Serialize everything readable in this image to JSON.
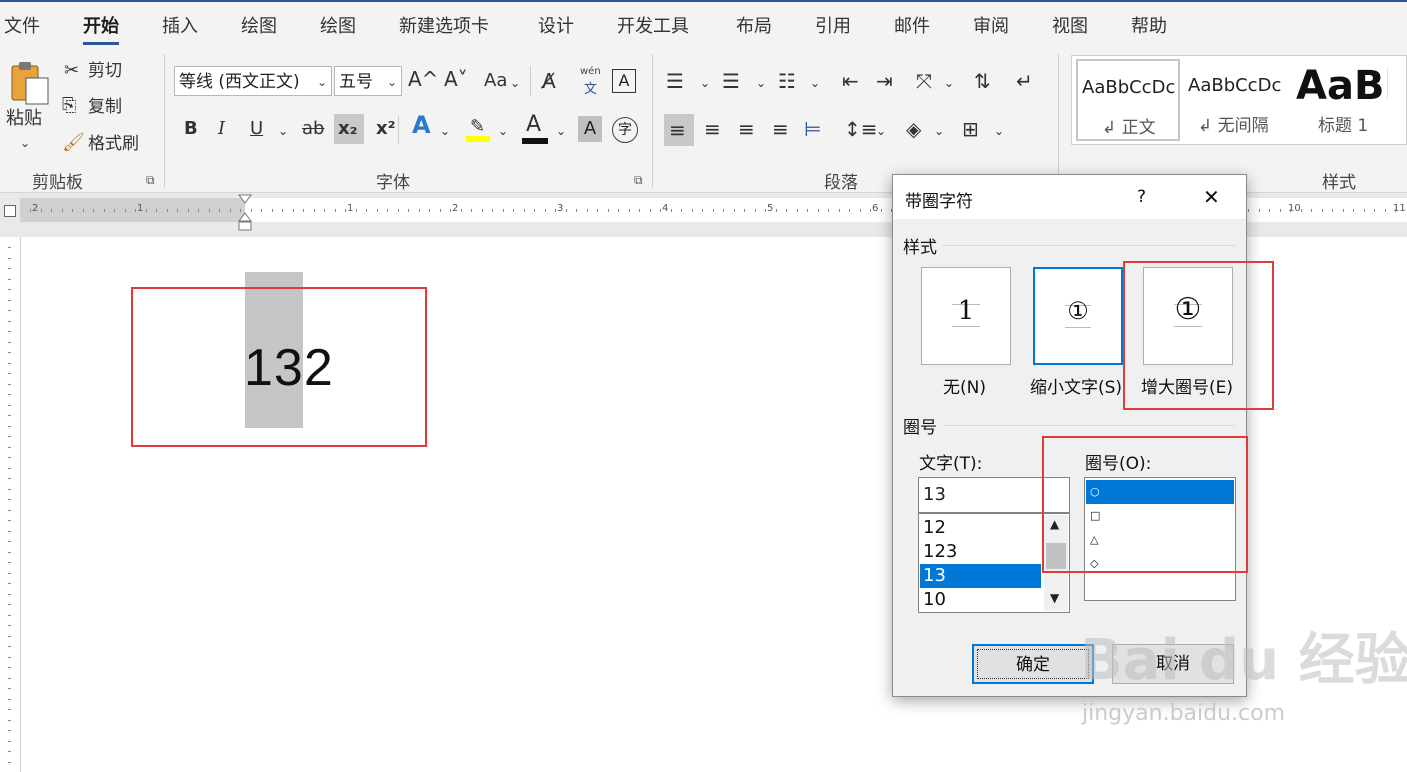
{
  "tabs": [
    "文件",
    "开始",
    "插入",
    "绘图",
    "绘图",
    "新建选项卡",
    "设计",
    "开发工具",
    "布局",
    "引用",
    "邮件",
    "审阅",
    "视图",
    "帮助"
  ],
  "active_tab": "开始",
  "clipboard": {
    "paste": "粘贴",
    "cut": "剪切",
    "copy": "复制",
    "format_painter": "格式刷",
    "group_label": "剪贴板"
  },
  "font": {
    "font_name": "等线 (西文正文)",
    "font_size": "五号",
    "group_label": "字体",
    "wen_pinyin": "wén",
    "wen_char": "文",
    "bold": "B",
    "italic": "I",
    "underline": "U",
    "strike": "ab",
    "sub": "x₂",
    "sup": "x²",
    "case": "Aa",
    "grow": "A^",
    "shrink": "A˅",
    "text_effect": "A",
    "font_color": "A",
    "char_shading": "A",
    "border_char": "A",
    "enclose_char": "字"
  },
  "paragraph": {
    "group_label": "段落"
  },
  "styles": {
    "group_label": "样式",
    "items": [
      {
        "sample": "AaBbCcDc",
        "name": "↲ 正文"
      },
      {
        "sample": "AaBbCcDc",
        "name": "↲ 无间隔"
      },
      {
        "sample": "AaBl",
        "name": "标题 1"
      }
    ]
  },
  "ruler_numbers": [
    "2",
    "1",
    "1",
    "2",
    "3",
    "4",
    "5",
    "6",
    "10",
    "11"
  ],
  "document": {
    "text": "132"
  },
  "dialog": {
    "title": "带圈字符",
    "help": "?",
    "close": "✕",
    "style_section": "样式",
    "style_options": [
      {
        "glyph": "1",
        "label": "无(N)"
      },
      {
        "glyph": "①",
        "label": "缩小文字(S)"
      },
      {
        "glyph": "①",
        "label": "增大圈号(E)"
      }
    ],
    "enclosure_section": "圈号",
    "text_label": "文字(T):",
    "text_value": "13",
    "text_list": [
      "12",
      "123",
      "13",
      "10"
    ],
    "text_selected": "13",
    "shape_label": "圈号(O):",
    "shape_list": [
      "○",
      "□",
      "△",
      "◇"
    ],
    "shape_selected": "○",
    "ok": "确定",
    "cancel": "取消"
  },
  "watermark": {
    "main": "Bai du 经验",
    "sub": "jingyan.baidu.com"
  },
  "colors": {
    "accent": "#2b579a",
    "selection": "#0078d7",
    "highlight_box": "#e03c3c",
    "highlight_yellow": "#ffff00",
    "font_red": "#c00000"
  }
}
